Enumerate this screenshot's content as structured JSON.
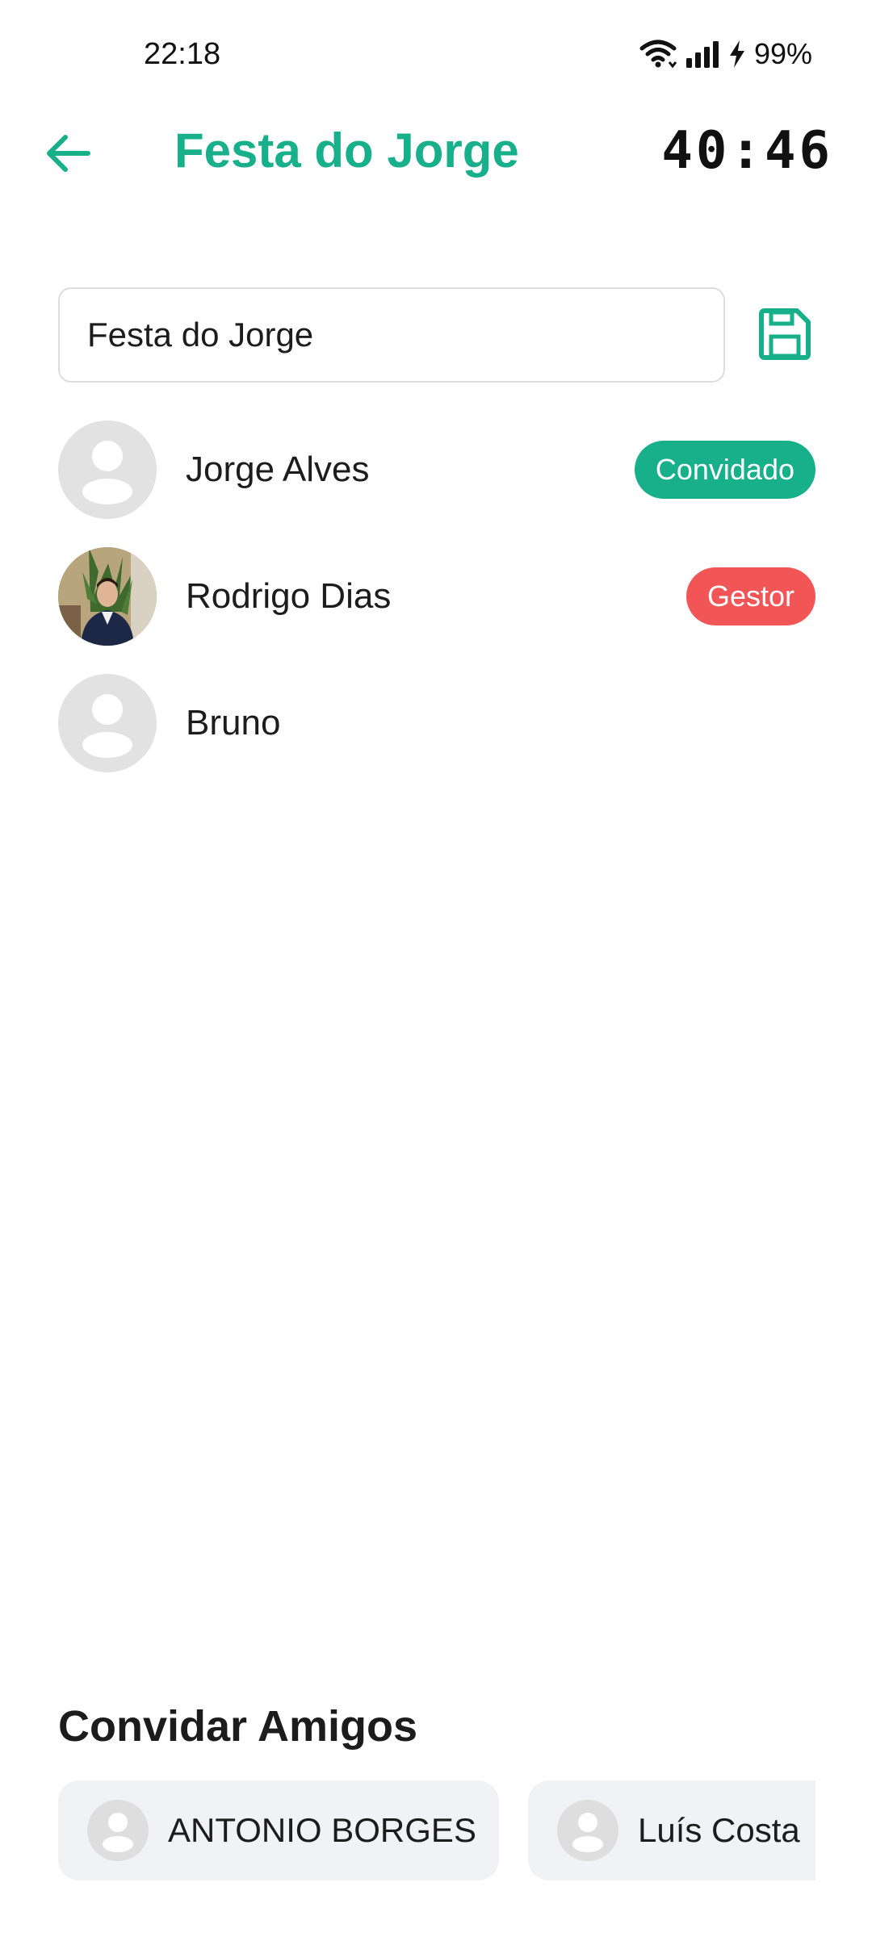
{
  "status_bar": {
    "time": "22:18",
    "battery": "99%",
    "icons": [
      "wifi-icon",
      "signal-icon",
      "charging-icon"
    ]
  },
  "header": {
    "title": "Festa do Jorge",
    "timer": "40:46",
    "accent_color": "#17b08a"
  },
  "event_name_input": {
    "value": "Festa do Jorge"
  },
  "participants": [
    {
      "name": "Jorge Alves",
      "role": "Convidado",
      "avatar": "default-avatar"
    },
    {
      "name": "Rodrigo Dias",
      "role": "Gestor",
      "avatar": "photo"
    },
    {
      "name": "Bruno",
      "role": "",
      "avatar": "default-avatar"
    }
  ],
  "badge_colors": {
    "Convidado": "#17b08a",
    "Gestor": "#f25556"
  },
  "invite": {
    "title": "Convidar Amigos",
    "friends": [
      {
        "name": "ANTONIO BORGES"
      },
      {
        "name": "Luís Costa"
      }
    ]
  }
}
